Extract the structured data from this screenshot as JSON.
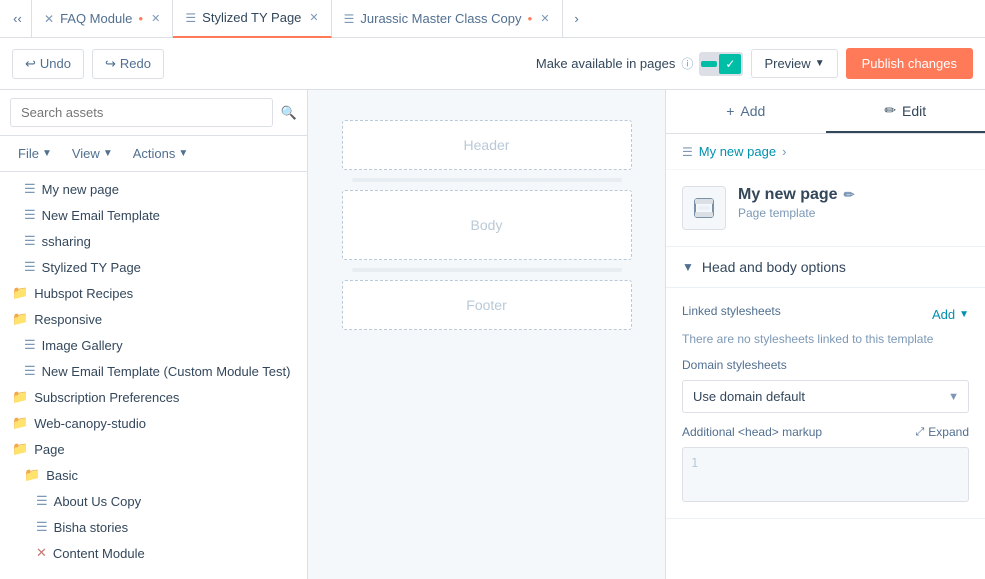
{
  "tabs": [
    {
      "id": "faq-module",
      "label": "FAQ Module",
      "active": false,
      "closable": true,
      "modified": true
    },
    {
      "id": "stylized-ty",
      "label": "Stylized TY Page",
      "active": true,
      "closable": true,
      "modified": false
    },
    {
      "id": "jurassic-master",
      "label": "Jurassic Master Class Copy",
      "active": false,
      "closable": true,
      "modified": true
    }
  ],
  "toolbar": {
    "undo_label": "Undo",
    "redo_label": "Redo",
    "make_available_label": "Make available in pages",
    "preview_label": "Preview",
    "publish_label": "Publish changes"
  },
  "sidebar": {
    "search_placeholder": "Search assets",
    "file_label": "File",
    "view_label": "View",
    "actions_label": "Actions",
    "tree_items": [
      {
        "id": "my-new-page",
        "label": "My new page",
        "type": "doc",
        "indent": 1
      },
      {
        "id": "new-email-template",
        "label": "New Email Template",
        "type": "doc",
        "indent": 1
      },
      {
        "id": "ssharing",
        "label": "ssharing",
        "type": "doc",
        "indent": 1
      },
      {
        "id": "stylized-ty-page",
        "label": "Stylized TY Page",
        "type": "doc",
        "indent": 1
      },
      {
        "id": "hubspot-recipes",
        "label": "Hubspot Recipes",
        "type": "folder",
        "indent": 0
      },
      {
        "id": "responsive",
        "label": "Responsive",
        "type": "folder",
        "indent": 0
      },
      {
        "id": "image-gallery",
        "label": "Image Gallery",
        "type": "doc",
        "indent": 1
      },
      {
        "id": "new-email-template-custom",
        "label": "New Email Template (Custom Module Test)",
        "type": "doc",
        "indent": 1
      },
      {
        "id": "subscription-preferences",
        "label": "Subscription Preferences",
        "type": "folder",
        "indent": 0
      },
      {
        "id": "web-canopy-studio",
        "label": "Web-canopy-studio",
        "type": "folder",
        "indent": 0
      },
      {
        "id": "page",
        "label": "Page",
        "type": "folder",
        "indent": 0
      },
      {
        "id": "basic",
        "label": "Basic",
        "type": "folder",
        "indent": 1
      },
      {
        "id": "about-us-copy",
        "label": "About Us Copy",
        "type": "doc",
        "indent": 2
      },
      {
        "id": "bisha-stories",
        "label": "Bisha stories",
        "type": "doc",
        "indent": 2
      },
      {
        "id": "content-module",
        "label": "Content Module",
        "type": "x",
        "indent": 2
      }
    ]
  },
  "canvas": {
    "header_label": "Header",
    "body_label": "Body",
    "footer_label": "Footer"
  },
  "right_panel": {
    "add_tab_label": "Add",
    "edit_tab_label": "Edit",
    "breadcrumb_label": "My new page",
    "page_name": "My new page",
    "page_template_label": "Page template",
    "section_title": "Head and body options",
    "linked_stylesheets_label": "Linked stylesheets",
    "add_label": "Add",
    "no_stylesheets_text": "There are no stylesheets linked to this template",
    "domain_stylesheets_label": "Domain stylesheets",
    "domain_default_option": "Use domain default",
    "additional_markup_label": "Additional <head> markup",
    "expand_label": "Expand",
    "line_number": "1"
  }
}
